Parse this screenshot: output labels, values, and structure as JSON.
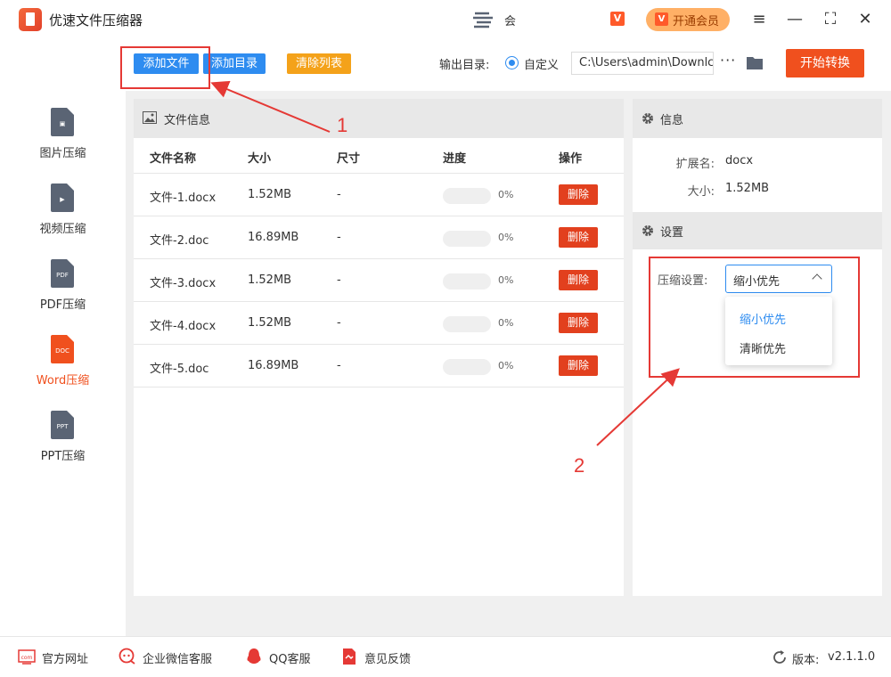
{
  "app": {
    "title": "优速文件压缩器",
    "user_name": "会",
    "vip_badge": "V",
    "vip_button": "开通会员"
  },
  "window_controls": {
    "menu": "≡",
    "minimize": "—",
    "maximize": "⛶",
    "close": "✕"
  },
  "toolbar": {
    "add_file": "添加文件",
    "add_directory": "添加目录",
    "clear_list": "清除列表",
    "output_label": "输出目录:",
    "custom_option": "自定义",
    "output_path": "C:\\Users\\admin\\Downlc",
    "more": "···",
    "start": "开始转换"
  },
  "sidebar": {
    "items": [
      {
        "label": "图片压缩",
        "glyph": "▣",
        "active": false
      },
      {
        "label": "视频压缩",
        "glyph": "▶",
        "active": false
      },
      {
        "label": "PDF压缩",
        "glyph": "PDF",
        "active": false
      },
      {
        "label": "Word压缩",
        "glyph": "DOC",
        "active": true
      },
      {
        "label": "PPT压缩",
        "glyph": "PPT",
        "active": false
      }
    ]
  },
  "file_panel": {
    "title": "文件信息",
    "columns": [
      "文件名称",
      "大小",
      "尺寸",
      "进度",
      "操作"
    ],
    "delete_label": "删除",
    "rows": [
      {
        "name": "文件-1.docx",
        "size": "1.52MB",
        "dimension": "-",
        "progress": 0,
        "progress_text": "0%"
      },
      {
        "name": "文件-2.doc",
        "size": "16.89MB",
        "dimension": "-",
        "progress": 0,
        "progress_text": "0%"
      },
      {
        "name": "文件-3.docx",
        "size": "1.52MB",
        "dimension": "-",
        "progress": 0,
        "progress_text": "0%"
      },
      {
        "name": "文件-4.docx",
        "size": "1.52MB",
        "dimension": "-",
        "progress": 0,
        "progress_text": "0%"
      },
      {
        "name": "文件-5.doc",
        "size": "16.89MB",
        "dimension": "-",
        "progress": 0,
        "progress_text": "0%"
      }
    ]
  },
  "info_panel": {
    "title": "信息",
    "extension_label": "扩展名:",
    "extension_value": "docx",
    "size_label": "大小:",
    "size_value": "1.52MB"
  },
  "settings_panel": {
    "title": "设置",
    "compress_label": "压缩设置:",
    "selected": "缩小优先",
    "options": [
      "缩小优先",
      "清晰优先"
    ]
  },
  "annotations": {
    "step1": "1",
    "step2": "2"
  },
  "footer": {
    "website": "官方网址",
    "wechat": "企业微信客服",
    "qq": "QQ客服",
    "feedback": "意见反馈",
    "version_label": "版本:",
    "version_value": "v2.1.1.0"
  },
  "colors": {
    "accent": "#2e8cf0",
    "primary": "#f0501e",
    "warning": "#f4a21a",
    "annotation": "#e53935"
  }
}
